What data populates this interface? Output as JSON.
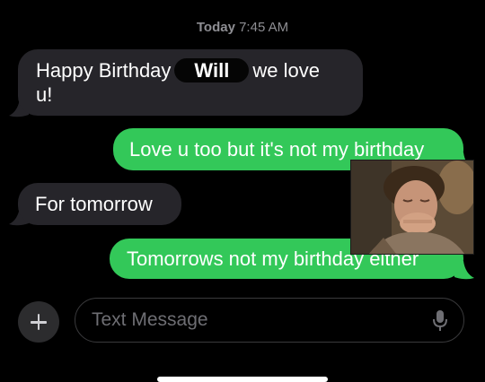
{
  "header": {
    "timestamp_day": "Today",
    "timestamp_time": "7:45 AM"
  },
  "messages": [
    {
      "direction": "incoming",
      "text_before": "Happy Birthday",
      "highlight": "Will",
      "text_after": "we love",
      "text_line2": "u!"
    },
    {
      "direction": "outgoing",
      "text": "Love u too but it's not my birthday"
    },
    {
      "direction": "incoming",
      "text": "For tomorrow"
    },
    {
      "direction": "outgoing",
      "text": "Tomorrows not my birthday either"
    }
  ],
  "sticker": {
    "icon": "crying-boy-sticker"
  },
  "composer": {
    "placeholder": "Text Message",
    "plus_icon": "plus-icon",
    "mic_icon": "microphone-icon"
  },
  "colors": {
    "background": "#000000",
    "incoming_bubble": "#26252a",
    "outgoing_bubble": "#33c859",
    "timestamp": "#8e8e93"
  }
}
